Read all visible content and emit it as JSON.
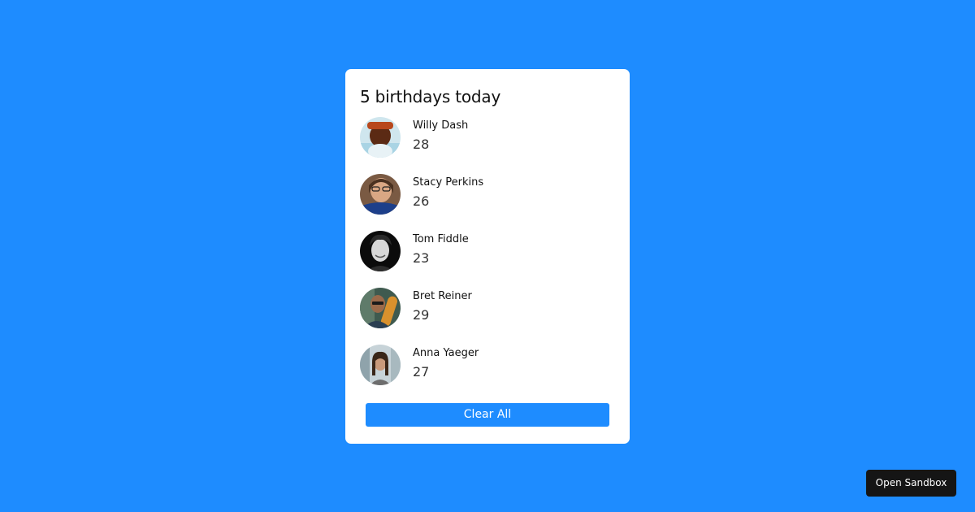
{
  "title": "5 birthdays today",
  "people": [
    {
      "name": "Willy Dash",
      "age": "28",
      "avatar": "avatar-photo"
    },
    {
      "name": "Stacy Perkins",
      "age": "26",
      "avatar": "avatar-photo"
    },
    {
      "name": "Tom Fiddle",
      "age": "23",
      "avatar": "avatar-photo"
    },
    {
      "name": "Bret Reiner",
      "age": "29",
      "avatar": "avatar-photo"
    },
    {
      "name": "Anna Yaeger",
      "age": "27",
      "avatar": "avatar-photo"
    }
  ],
  "clear_button_label": "Clear All",
  "sandbox_button_label": "Open Sandbox",
  "colors": {
    "background": "#1e8cff",
    "card": "#ffffff",
    "accent": "#1e8cff",
    "sandbox_button": "#151515"
  }
}
